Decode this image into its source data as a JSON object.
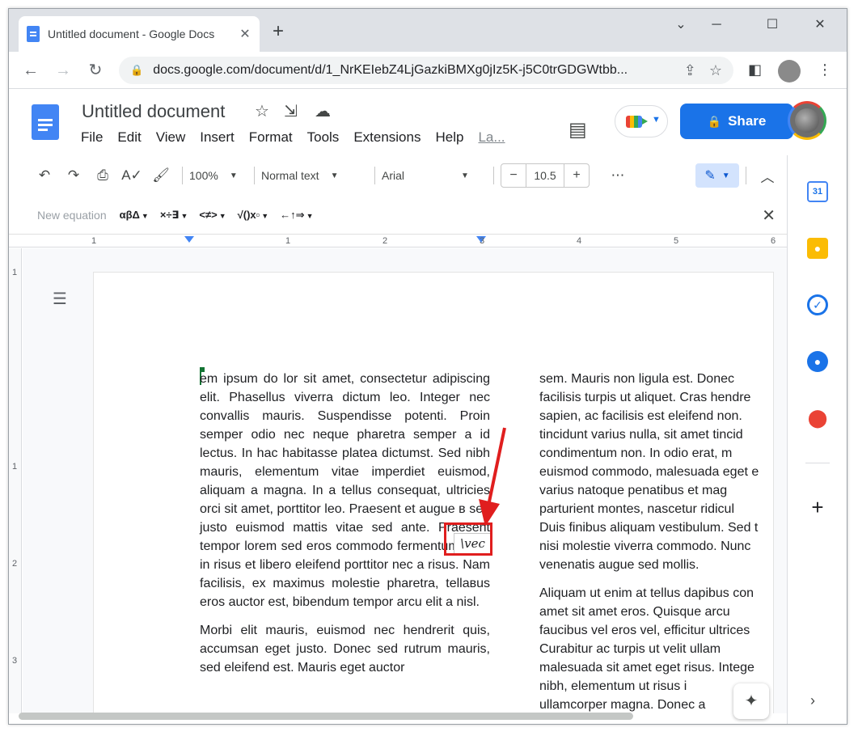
{
  "browser": {
    "tab_title": "Untitled document - Google Docs",
    "tab_close": "✕",
    "new_tab": "+",
    "win_min": "⌄",
    "win_minimize": "─",
    "win_maximize": "☐",
    "win_close": "✕",
    "back": "←",
    "forward": "→",
    "reload": "↻",
    "url": "docs.google.com/document/d/1_NrKEIebZ4LjGazkiBMXg0jIz5K-j5C0trGDGWtbb..."
  },
  "docs": {
    "title": "Untitled document",
    "menu": [
      "File",
      "Edit",
      "View",
      "Insert",
      "Format",
      "Tools",
      "Extensions",
      "Help",
      "La..."
    ],
    "share_label": "Share"
  },
  "toolbar": {
    "zoom": "100%",
    "style": "Normal text",
    "font": "Arial",
    "font_size": "10.5",
    "minus": "−",
    "plus": "+",
    "more": "⋯"
  },
  "equation_bar": {
    "new_equation": "New equation",
    "groups": [
      "αβΔ",
      "×÷∃",
      "<≠>",
      "√()x▫",
      "←↑⇒"
    ],
    "close": "✕"
  },
  "ruler": {
    "marks": [
      "1",
      "1",
      "2",
      "3",
      "4",
      "5",
      "6"
    ],
    "vmarks": [
      "1",
      "1",
      "2",
      "3"
    ]
  },
  "document": {
    "column1": [
      "em ipsum do lor sit amet, consectetur adipiscing elit. Phasellus viverra dictum leo. Integer nec convallis mauris. Suspendisse potenti. Proin semper odio nec neque pharetra semper a id lectus. In hac habitasse platea dictumst. Sed nibh mauris, elementum vitae imperdiet euismod, aliquam a magna. In a tellus consequat, ultricies orci sit amet, porttitor leo. Praesent et augue в sed justo euismod mattis vitae sed ante. Praesent          tempor lorem sed eros commodo fermentum. Sed in risus et libero eleifend porttitor nec a risus. Nam facilisis, ex maximus molestie pharetra, tellавus eros auctor est, bibendum tempor arcu elit a nisl.",
      "Morbi elit mauris, euismod nec hendrerit quis, accumsan eget justo. Donec sed rutrum mauris, sed eleifend est. Mauris eget auctor"
    ],
    "column2_lines": [
      [
        "sem. Mauris non ligula est. Donec",
        "facilisis turpis ut aliquet. Cras hendre",
        "sapien, ac facilisis est eleifend non.",
        "tincidunt varius nulla, sit amet tincid",
        "condimentum non. In odio erat, m",
        "euismod commodo, malesuada eget e",
        "varius natoque penatibus et mag",
        "parturient montes, nascetur ridicul",
        "Duis finibus aliquam vestibulum. Sed t",
        "nisi molestie viverra commodo. Nunc",
        "venenatis augue sed mollis."
      ],
      [
        "Aliquam ut enim at tellus dapibus con",
        "amet sit amet eros. Quisque arcu",
        "faucibus vel eros vel, efficitur ultrices",
        "Curabitur ac turpis ut velit ullam",
        "malesuada sit amet eget risus. Intege",
        "nibh, elementum ut risus i",
        "ullamcorper magna. Donec a"
      ]
    ],
    "equation_text": "\\vec"
  },
  "side_panel": {
    "calendar_day": "31"
  },
  "colors": {
    "accent": "#1a73e8",
    "highlight_box": "#e01e1e"
  }
}
